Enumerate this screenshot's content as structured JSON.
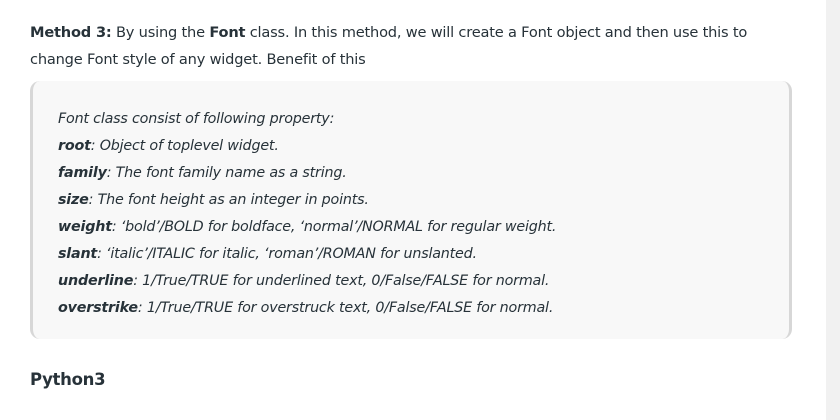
{
  "intro": {
    "method_label": "Method 3:",
    "text_before": " By using the ",
    "class_name": "Font",
    "text_after": " class. In this method, we will create a Font object and then use this to change Font style of any widget. Benefit of this"
  },
  "note": {
    "heading": "Font class consist of following property:",
    "properties": [
      {
        "name": "root",
        "desc": ": Object of toplevel widget."
      },
      {
        "name": "family",
        "desc": ": The font family name as a string."
      },
      {
        "name": "size",
        "desc": ": The font height as an integer in points."
      },
      {
        "name": "weight",
        "desc": ": ‘bold’/BOLD for boldface, ‘normal’/NORMAL for regular weight."
      },
      {
        "name": "slant",
        "desc": ": ‘italic’/ITALIC for italic, ‘roman’/ROMAN for unslanted."
      },
      {
        "name": "underline",
        "desc": ": 1/True/TRUE for underlined text, 0/False/FALSE for normal."
      },
      {
        "name": "overstrike",
        "desc": ": 1/True/TRUE for overstruck text, 0/False/FALSE for normal."
      }
    ]
  },
  "section": {
    "heading": "Python3"
  }
}
